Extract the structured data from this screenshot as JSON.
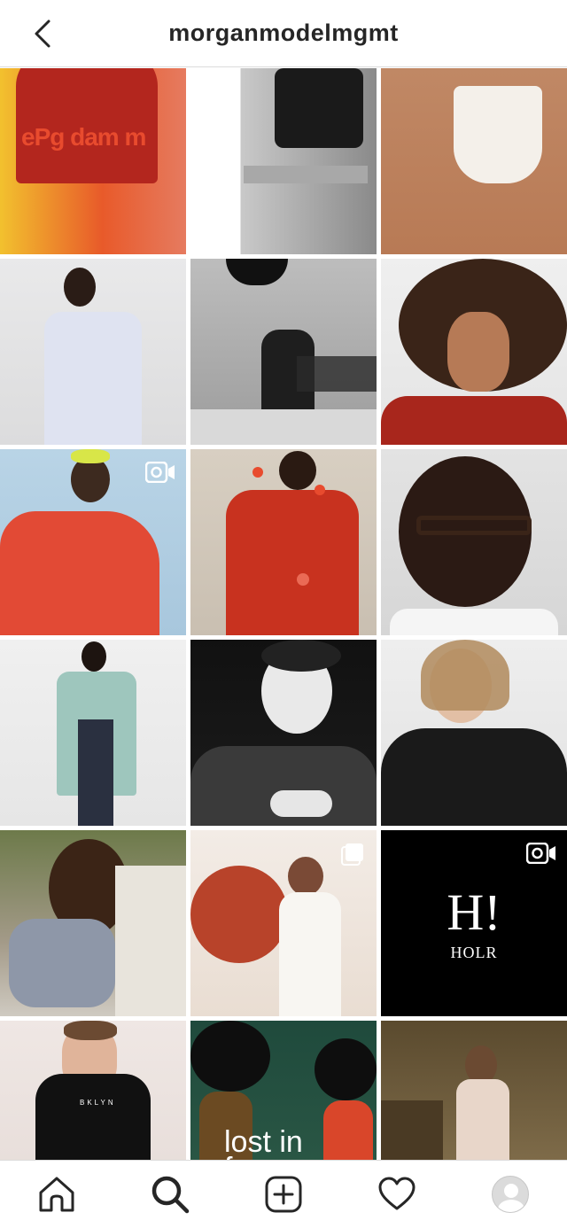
{
  "header": {
    "title": "morganmodelmgmt",
    "back_icon": "chevron-left-icon"
  },
  "grid": {
    "tiles": [
      {
        "id": "post-1",
        "bg": "linear-gradient(90deg,#f2c12e 0%,#e85a2a 55%,#e67b60 100%)",
        "fig": "#b3261e",
        "badge": ""
      },
      {
        "id": "post-2",
        "bg": "linear-gradient(90deg,#ffffff 0%,#ffffff 27%,#c9c9c9 27%,#8a8a8a 100%)",
        "fig": "#1a1a1a",
        "badge": ""
      },
      {
        "id": "post-3",
        "bg": "linear-gradient(180deg,#c08865 0%,#b87a55 100%)",
        "fig": "#f4f0ea",
        "badge": ""
      },
      {
        "id": "post-4",
        "bg": "linear-gradient(180deg,#e9e9ea 0%,#dcdcdd 100%)",
        "fig": "#dfe3f1",
        "badge": ""
      },
      {
        "id": "post-5",
        "bg": "linear-gradient(180deg,#bdbdbd 0%,#9c9c9c 100%)",
        "fig": "#1e1e1e",
        "badge": ""
      },
      {
        "id": "post-6",
        "bg": "linear-gradient(180deg,#efefef 0%,#e4e4e4 100%)",
        "fig": "#3a2418",
        "badge": ""
      },
      {
        "id": "post-7",
        "bg": "linear-gradient(180deg,#b9d4e6 0%,#a8c7dd 100%)",
        "fig": "#e24a35",
        "badge": "video"
      },
      {
        "id": "post-8",
        "bg": "linear-gradient(180deg,#d8cfc2 0%,#c9bfb1 100%)",
        "fig": "#c8321f",
        "badge": ""
      },
      {
        "id": "post-9",
        "bg": "linear-gradient(180deg,#e3e3e3 0%,#d6d6d6 100%)",
        "fig": "#2b1a14",
        "badge": ""
      },
      {
        "id": "post-10",
        "bg": "linear-gradient(180deg,#f0f0f0 0%,#e6e6e6 100%)",
        "fig": "#9ec6bd",
        "badge": ""
      },
      {
        "id": "post-11",
        "bg": "linear-gradient(180deg,#111111 0%,#1c1c1c 100%)",
        "fig": "#3a3a3a",
        "badge": ""
      },
      {
        "id": "post-12",
        "bg": "linear-gradient(180deg,#eeeeee 0%,#e2e2e2 100%)",
        "fig": "#1a1a1a",
        "badge": ""
      },
      {
        "id": "post-13",
        "bg": "linear-gradient(180deg,#6d7a4a 0%,#a39a88 60%,#cfcac1 100%)",
        "fig": "#3b2416",
        "badge": ""
      },
      {
        "id": "post-14",
        "bg": "linear-gradient(180deg,#f3ece6 0%,#e9ddd2 100%)",
        "fig": "#b8432a",
        "badge": "multi"
      },
      {
        "id": "post-15",
        "bg": "#000000",
        "fig": "#000000",
        "badge": "video"
      },
      {
        "id": "post-16",
        "bg": "linear-gradient(180deg,#efe7e4 0%,#e6dcd8 100%)",
        "fig": "#111111",
        "badge": ""
      },
      {
        "id": "post-17",
        "bg": "linear-gradient(180deg,#1f4a3c 0%,#2d5a47 100%)",
        "fig": "#1a1a1a",
        "badge": ""
      },
      {
        "id": "post-18",
        "bg": "linear-gradient(180deg,#5a4a2e 0%,#8a7652 100%)",
        "fig": "#e8d6c9",
        "badge": ""
      },
      {
        "id": "post-19",
        "bg": "linear-gradient(180deg,#bfc8cc 0%,#8fa1a8 100%)",
        "fig": "#6c7a80",
        "badge": ""
      },
      {
        "id": "post-20",
        "bg": "linear-gradient(180deg,#c9a99a 0%,#b08977 100%)",
        "fig": "#3a2c28",
        "badge": ""
      },
      {
        "id": "post-21",
        "bg": "linear-gradient(180deg,#f4dcc9 0%,#ecc9b2 100%)",
        "fig": "#e9c0a4",
        "badge": ""
      }
    ],
    "captions": {
      "post-1": "ePg dam m",
      "post-15_top": "H!",
      "post-15_bottom": "HOLR",
      "post-16": "BKLYN",
      "post-17_line1": "lost in",
      "post-17_line2": "fro"
    }
  },
  "bottom_nav": {
    "items": [
      {
        "name": "home",
        "icon": "home-icon"
      },
      {
        "name": "search",
        "icon": "search-icon",
        "active": true
      },
      {
        "name": "new-post",
        "icon": "add-post-icon"
      },
      {
        "name": "activity",
        "icon": "heart-icon"
      },
      {
        "name": "profile",
        "icon": "avatar-icon"
      }
    ]
  }
}
